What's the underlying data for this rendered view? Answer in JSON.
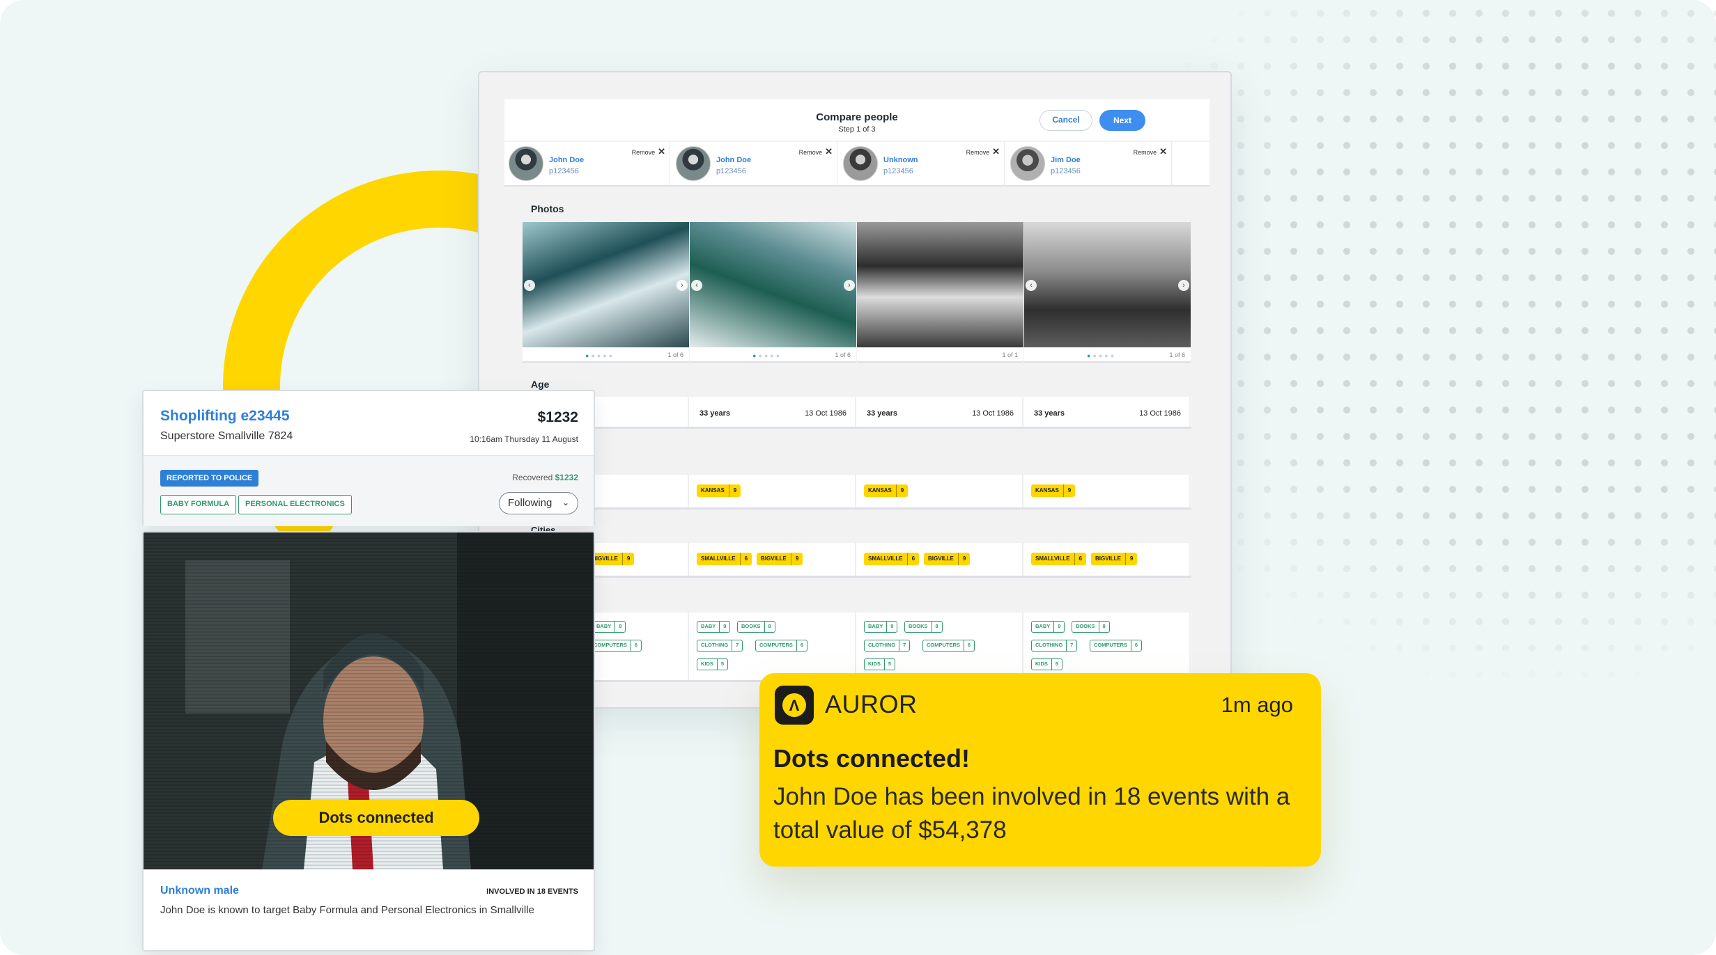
{
  "compare": {
    "title": "Compare people",
    "step": "Step 1 of 3",
    "cancel": "Cancel",
    "next": "Next",
    "remove_label": "Remove",
    "people": [
      {
        "name": "John Doe",
        "id": "p123456"
      },
      {
        "name": "John Doe",
        "id": "p123456"
      },
      {
        "name": "Unknown",
        "id": "p123456"
      },
      {
        "name": "Jim Doe",
        "id": "p123456"
      }
    ],
    "photos_label": "Photos",
    "photo_counts": [
      "1 of 6",
      "1 of 6",
      "1 of 1",
      "1 of 6"
    ],
    "age_label": "Age",
    "ages": [
      {
        "age": "33 years",
        "dob": "13 Oct 1986"
      },
      {
        "age": "33 years",
        "dob": "13 Oct 1986"
      },
      {
        "age": "33 years",
        "dob": "13 Oct 1986"
      }
    ],
    "state_tag": {
      "name": "KANSAS",
      "count": "9"
    },
    "cities_label": "Cities",
    "city_tags": [
      {
        "name": "SMALLVILLE",
        "count": "6"
      },
      {
        "name": "BIGVILLE",
        "count": "9"
      }
    ],
    "category_tags": [
      {
        "name": "BABY",
        "count": "9"
      },
      {
        "name": "BOOKS",
        "count": "8"
      },
      {
        "name": "CLOTHING",
        "count": "7"
      },
      {
        "name": "COMPUTERS",
        "count": "6"
      },
      {
        "name": "KIDS",
        "count": "5"
      }
    ]
  },
  "incident": {
    "title": "Shoplifting e23445",
    "location": "Superstore Smallville 7824",
    "amount": "$1232",
    "time": "10:16am Thursday 11 August",
    "police_badge": "REPORTED TO POLICE",
    "tags": [
      "BABY FORMULA",
      "PERSONAL ELECTRONICS"
    ],
    "recovered_label": "Recovered",
    "recovered_value": "$1232",
    "follow_label": "Following"
  },
  "suspect": {
    "pill": "Dots connected",
    "name": "Unknown male",
    "events": "INVOLVED IN 18 EVENTS",
    "description": "John Doe is known to target Baby Formula and Personal Electronics in Smallville"
  },
  "notification": {
    "app": "AUROR",
    "time": "1m ago",
    "heading": "Dots connected!",
    "body": "John Doe has been involved in 18 events with a total value of $54,378"
  },
  "colors": {
    "brand_yellow": "#ffd600",
    "link_blue": "#2e7fd6",
    "tag_green": "#2f9a6e",
    "background": "#eef7f5"
  }
}
